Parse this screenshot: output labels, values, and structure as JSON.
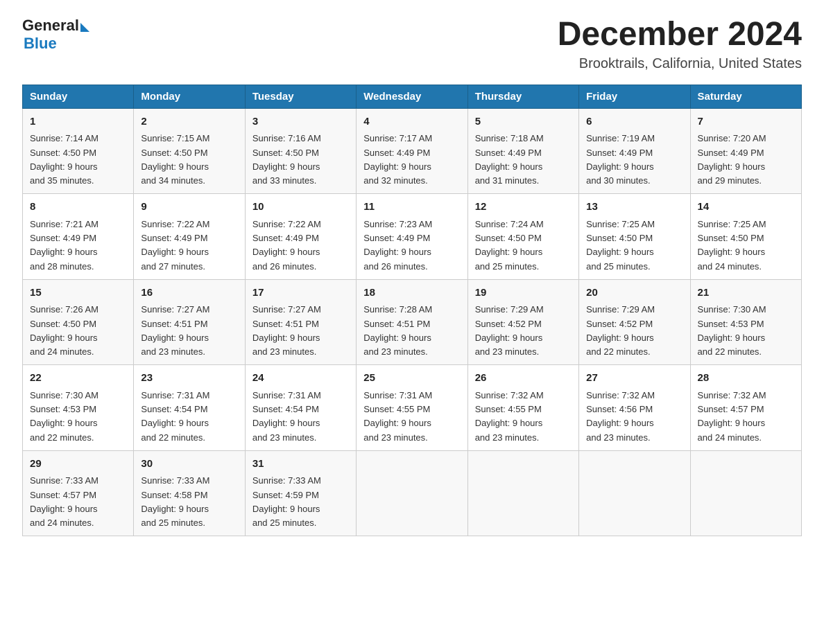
{
  "header": {
    "logo_general": "General",
    "logo_blue": "Blue",
    "title": "December 2024",
    "location": "Brooktrails, California, United States"
  },
  "days_of_week": [
    "Sunday",
    "Monday",
    "Tuesday",
    "Wednesday",
    "Thursday",
    "Friday",
    "Saturday"
  ],
  "weeks": [
    [
      {
        "day": "1",
        "sunrise": "7:14 AM",
        "sunset": "4:50 PM",
        "daylight": "9 hours and 35 minutes."
      },
      {
        "day": "2",
        "sunrise": "7:15 AM",
        "sunset": "4:50 PM",
        "daylight": "9 hours and 34 minutes."
      },
      {
        "day": "3",
        "sunrise": "7:16 AM",
        "sunset": "4:50 PM",
        "daylight": "9 hours and 33 minutes."
      },
      {
        "day": "4",
        "sunrise": "7:17 AM",
        "sunset": "4:49 PM",
        "daylight": "9 hours and 32 minutes."
      },
      {
        "day": "5",
        "sunrise": "7:18 AM",
        "sunset": "4:49 PM",
        "daylight": "9 hours and 31 minutes."
      },
      {
        "day": "6",
        "sunrise": "7:19 AM",
        "sunset": "4:49 PM",
        "daylight": "9 hours and 30 minutes."
      },
      {
        "day": "7",
        "sunrise": "7:20 AM",
        "sunset": "4:49 PM",
        "daylight": "9 hours and 29 minutes."
      }
    ],
    [
      {
        "day": "8",
        "sunrise": "7:21 AM",
        "sunset": "4:49 PM",
        "daylight": "9 hours and 28 minutes."
      },
      {
        "day": "9",
        "sunrise": "7:22 AM",
        "sunset": "4:49 PM",
        "daylight": "9 hours and 27 minutes."
      },
      {
        "day": "10",
        "sunrise": "7:22 AM",
        "sunset": "4:49 PM",
        "daylight": "9 hours and 26 minutes."
      },
      {
        "day": "11",
        "sunrise": "7:23 AM",
        "sunset": "4:49 PM",
        "daylight": "9 hours and 26 minutes."
      },
      {
        "day": "12",
        "sunrise": "7:24 AM",
        "sunset": "4:50 PM",
        "daylight": "9 hours and 25 minutes."
      },
      {
        "day": "13",
        "sunrise": "7:25 AM",
        "sunset": "4:50 PM",
        "daylight": "9 hours and 25 minutes."
      },
      {
        "day": "14",
        "sunrise": "7:25 AM",
        "sunset": "4:50 PM",
        "daylight": "9 hours and 24 minutes."
      }
    ],
    [
      {
        "day": "15",
        "sunrise": "7:26 AM",
        "sunset": "4:50 PM",
        "daylight": "9 hours and 24 minutes."
      },
      {
        "day": "16",
        "sunrise": "7:27 AM",
        "sunset": "4:51 PM",
        "daylight": "9 hours and 23 minutes."
      },
      {
        "day": "17",
        "sunrise": "7:27 AM",
        "sunset": "4:51 PM",
        "daylight": "9 hours and 23 minutes."
      },
      {
        "day": "18",
        "sunrise": "7:28 AM",
        "sunset": "4:51 PM",
        "daylight": "9 hours and 23 minutes."
      },
      {
        "day": "19",
        "sunrise": "7:29 AM",
        "sunset": "4:52 PM",
        "daylight": "9 hours and 23 minutes."
      },
      {
        "day": "20",
        "sunrise": "7:29 AM",
        "sunset": "4:52 PM",
        "daylight": "9 hours and 22 minutes."
      },
      {
        "day": "21",
        "sunrise": "7:30 AM",
        "sunset": "4:53 PM",
        "daylight": "9 hours and 22 minutes."
      }
    ],
    [
      {
        "day": "22",
        "sunrise": "7:30 AM",
        "sunset": "4:53 PM",
        "daylight": "9 hours and 22 minutes."
      },
      {
        "day": "23",
        "sunrise": "7:31 AM",
        "sunset": "4:54 PM",
        "daylight": "9 hours and 22 minutes."
      },
      {
        "day": "24",
        "sunrise": "7:31 AM",
        "sunset": "4:54 PM",
        "daylight": "9 hours and 23 minutes."
      },
      {
        "day": "25",
        "sunrise": "7:31 AM",
        "sunset": "4:55 PM",
        "daylight": "9 hours and 23 minutes."
      },
      {
        "day": "26",
        "sunrise": "7:32 AM",
        "sunset": "4:55 PM",
        "daylight": "9 hours and 23 minutes."
      },
      {
        "day": "27",
        "sunrise": "7:32 AM",
        "sunset": "4:56 PM",
        "daylight": "9 hours and 23 minutes."
      },
      {
        "day": "28",
        "sunrise": "7:32 AM",
        "sunset": "4:57 PM",
        "daylight": "9 hours and 24 minutes."
      }
    ],
    [
      {
        "day": "29",
        "sunrise": "7:33 AM",
        "sunset": "4:57 PM",
        "daylight": "9 hours and 24 minutes."
      },
      {
        "day": "30",
        "sunrise": "7:33 AM",
        "sunset": "4:58 PM",
        "daylight": "9 hours and 25 minutes."
      },
      {
        "day": "31",
        "sunrise": "7:33 AM",
        "sunset": "4:59 PM",
        "daylight": "9 hours and 25 minutes."
      },
      null,
      null,
      null,
      null
    ]
  ],
  "labels": {
    "sunrise": "Sunrise:",
    "sunset": "Sunset:",
    "daylight": "Daylight:"
  }
}
